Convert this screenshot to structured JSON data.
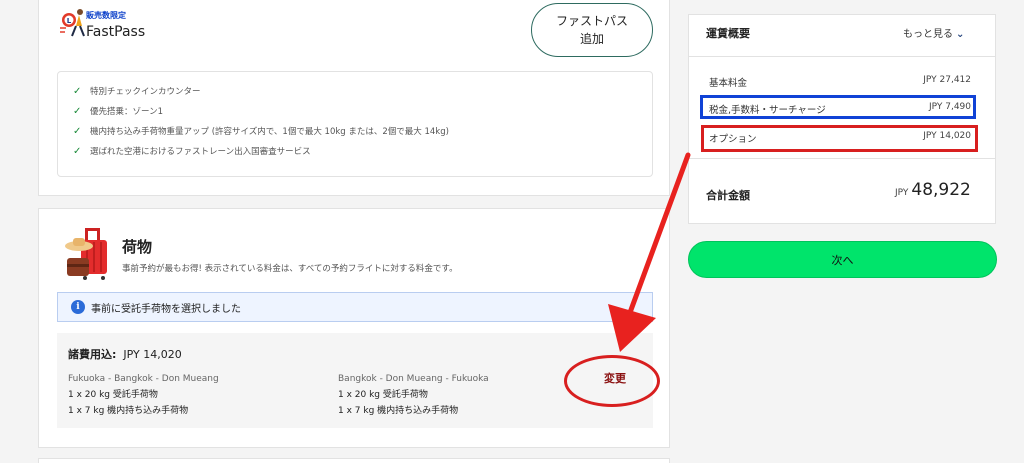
{
  "fastpass": {
    "badge": "販売数限定",
    "title": "FastPass",
    "add_button_line1": "ファストパス",
    "add_button_line2": "追加",
    "features": [
      "特別チェックインカウンター",
      "優先搭乗：ゾーン1",
      "機内持ち込み手荷物重量アップ (許容サイズ内で、1個で最大 10kg または、2個で最大 14kg)",
      "選ばれた空港におけるファストレーン出入国審査サービス"
    ]
  },
  "baggage": {
    "title": "荷物",
    "description": "事前予約が最もお得! 表示されている料金は、すべての予約フライトに対する料金です。",
    "info_message": "事前に受託手荷物を選択しました",
    "fee_label": "諸費用込",
    "fee_value": "JPY 14,020",
    "routes": [
      {
        "name": "Fukuoka - Bangkok - Don Mueang",
        "items": [
          "1 x 20 kg 受託手荷物",
          "1 x 7 kg 機内持ち込み手荷物"
        ]
      },
      {
        "name": "Bangkok - Don Mueang - Fukuoka",
        "items": [
          "1 x 20 kg 受託手荷物",
          "1 x 7 kg 機内持ち込み手荷物"
        ]
      }
    ],
    "change_label": "変更"
  },
  "fare_summary": {
    "title": "運賃概要",
    "more_label": "もっと見る",
    "rows": [
      {
        "label": "基本料金",
        "value": "JPY 27,412"
      },
      {
        "label": "税金,手数料・サーチャージ",
        "value": "JPY 7,490"
      },
      {
        "label": "オプション",
        "value": "JPY 14,020"
      }
    ],
    "total_label": "合計金額",
    "total_currency": "JPY",
    "total_value": "48,922"
  },
  "next_button": "次へ",
  "colors": {
    "accent_green": "#00e46b",
    "annotation_red": "#d81f1f",
    "annotation_blue": "#1042d6",
    "check_green": "#1b8a3a"
  }
}
